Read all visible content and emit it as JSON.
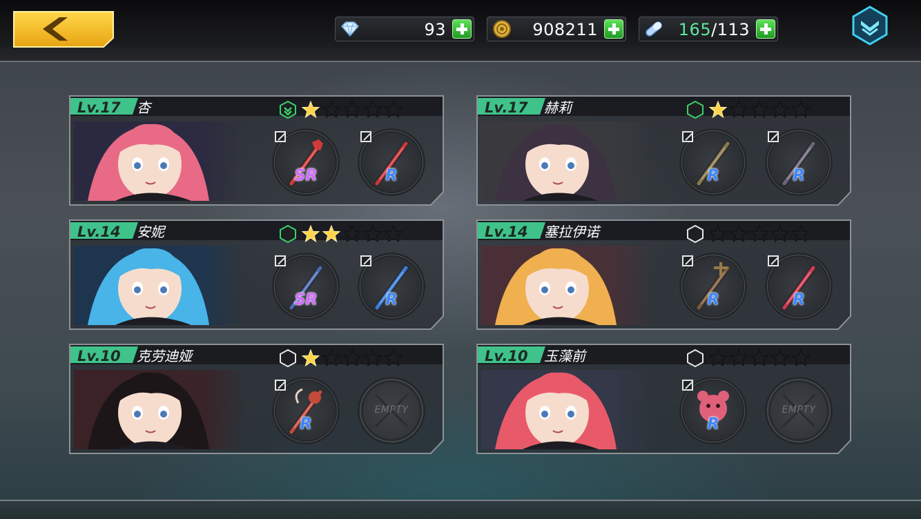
{
  "topbar": {
    "back_icon": "chevron-left-icon",
    "resources": [
      {
        "name": "diamond",
        "icon": "diamond-icon",
        "value": "93"
      },
      {
        "name": "gold",
        "icon": "gold-coin-icon",
        "value": "908211"
      },
      {
        "name": "stamina",
        "icon": "capsule-icon",
        "current": "165",
        "max": "/113"
      }
    ],
    "menu_icon": "chevron-down-menu-icon"
  },
  "characters": [
    {
      "level": "Lv.17",
      "name": "杏",
      "rank_icon": "hexagon-chevron-icon",
      "rank_color": "#3bd16a",
      "stars": 1,
      "max_stars": 5,
      "hair": "#e86a86",
      "portrait_bg": "#2b2940",
      "slots": [
        {
          "rarity": "SR",
          "weapon_icon": "wrench-icon",
          "weapon_color": "#d23a3a"
        },
        {
          "rarity": "R",
          "weapon_icon": "crowbar-icon",
          "weapon_color": "#c93838"
        }
      ]
    },
    {
      "level": "Lv.17",
      "name": "赫莉",
      "rank_icon": "hexagon-icon",
      "rank_color": "#3bd16a",
      "stars": 1,
      "max_stars": 5,
      "hair": "#3d3242",
      "portrait_bg": "#3a3a3e",
      "slots": [
        {
          "rarity": "R",
          "weapon_icon": "rifle-icon",
          "weapon_color": "#8a7a4a"
        },
        {
          "rarity": "R",
          "weapon_icon": "gun-icon",
          "weapon_color": "#6a6478"
        }
      ]
    },
    {
      "level": "Lv.14",
      "name": "安妮",
      "rank_icon": "hexagon-icon",
      "rank_color": "#3bd16a",
      "stars": 2,
      "max_stars": 5,
      "hair": "#48b4e8",
      "portrait_bg": "#1e3550",
      "slots": [
        {
          "rarity": "SR",
          "weapon_icon": "cannon-icon",
          "weapon_color": "#4a6ab0"
        },
        {
          "rarity": "R",
          "weapon_icon": "staff-icon",
          "weapon_color": "#3a7ed6"
        }
      ]
    },
    {
      "level": "Lv.14",
      "name": "塞拉伊诺",
      "rank_icon": "hexagon-icon",
      "rank_color": "#1d1f22",
      "stars": 0,
      "max_stars": 5,
      "hair": "#f0b050",
      "portrait_bg": "#4a3036",
      "slots": [
        {
          "rarity": "R",
          "weapon_icon": "anchor-staff-icon",
          "weapon_color": "#7a5a3a"
        },
        {
          "rarity": "R",
          "weapon_icon": "blade-icon",
          "weapon_color": "#d23a52"
        }
      ]
    },
    {
      "level": "Lv.10",
      "name": "克劳迪娅",
      "rank_icon": "hexagon-icon",
      "rank_color": "#1d1f22",
      "stars": 1,
      "max_stars": 5,
      "hair": "#1c1618",
      "portrait_bg": "#3a2226",
      "slots": [
        {
          "rarity": "R",
          "weapon_icon": "rose-staff-icon",
          "weapon_color": "#c44a3a"
        },
        {
          "rarity": "",
          "empty_label": "EMPTY"
        }
      ]
    },
    {
      "level": "Lv.10",
      "name": "玉藻前",
      "rank_icon": "hexagon-icon",
      "rank_color": "#1d1f22",
      "stars": 0,
      "max_stars": 5,
      "hair": "#e85a6a",
      "portrait_bg": "#35384a",
      "slots": [
        {
          "rarity": "R",
          "weapon_icon": "bear-icon",
          "weapon_color": "#e0607a"
        },
        {
          "rarity": "",
          "empty_label": "EMPTY"
        }
      ]
    }
  ]
}
